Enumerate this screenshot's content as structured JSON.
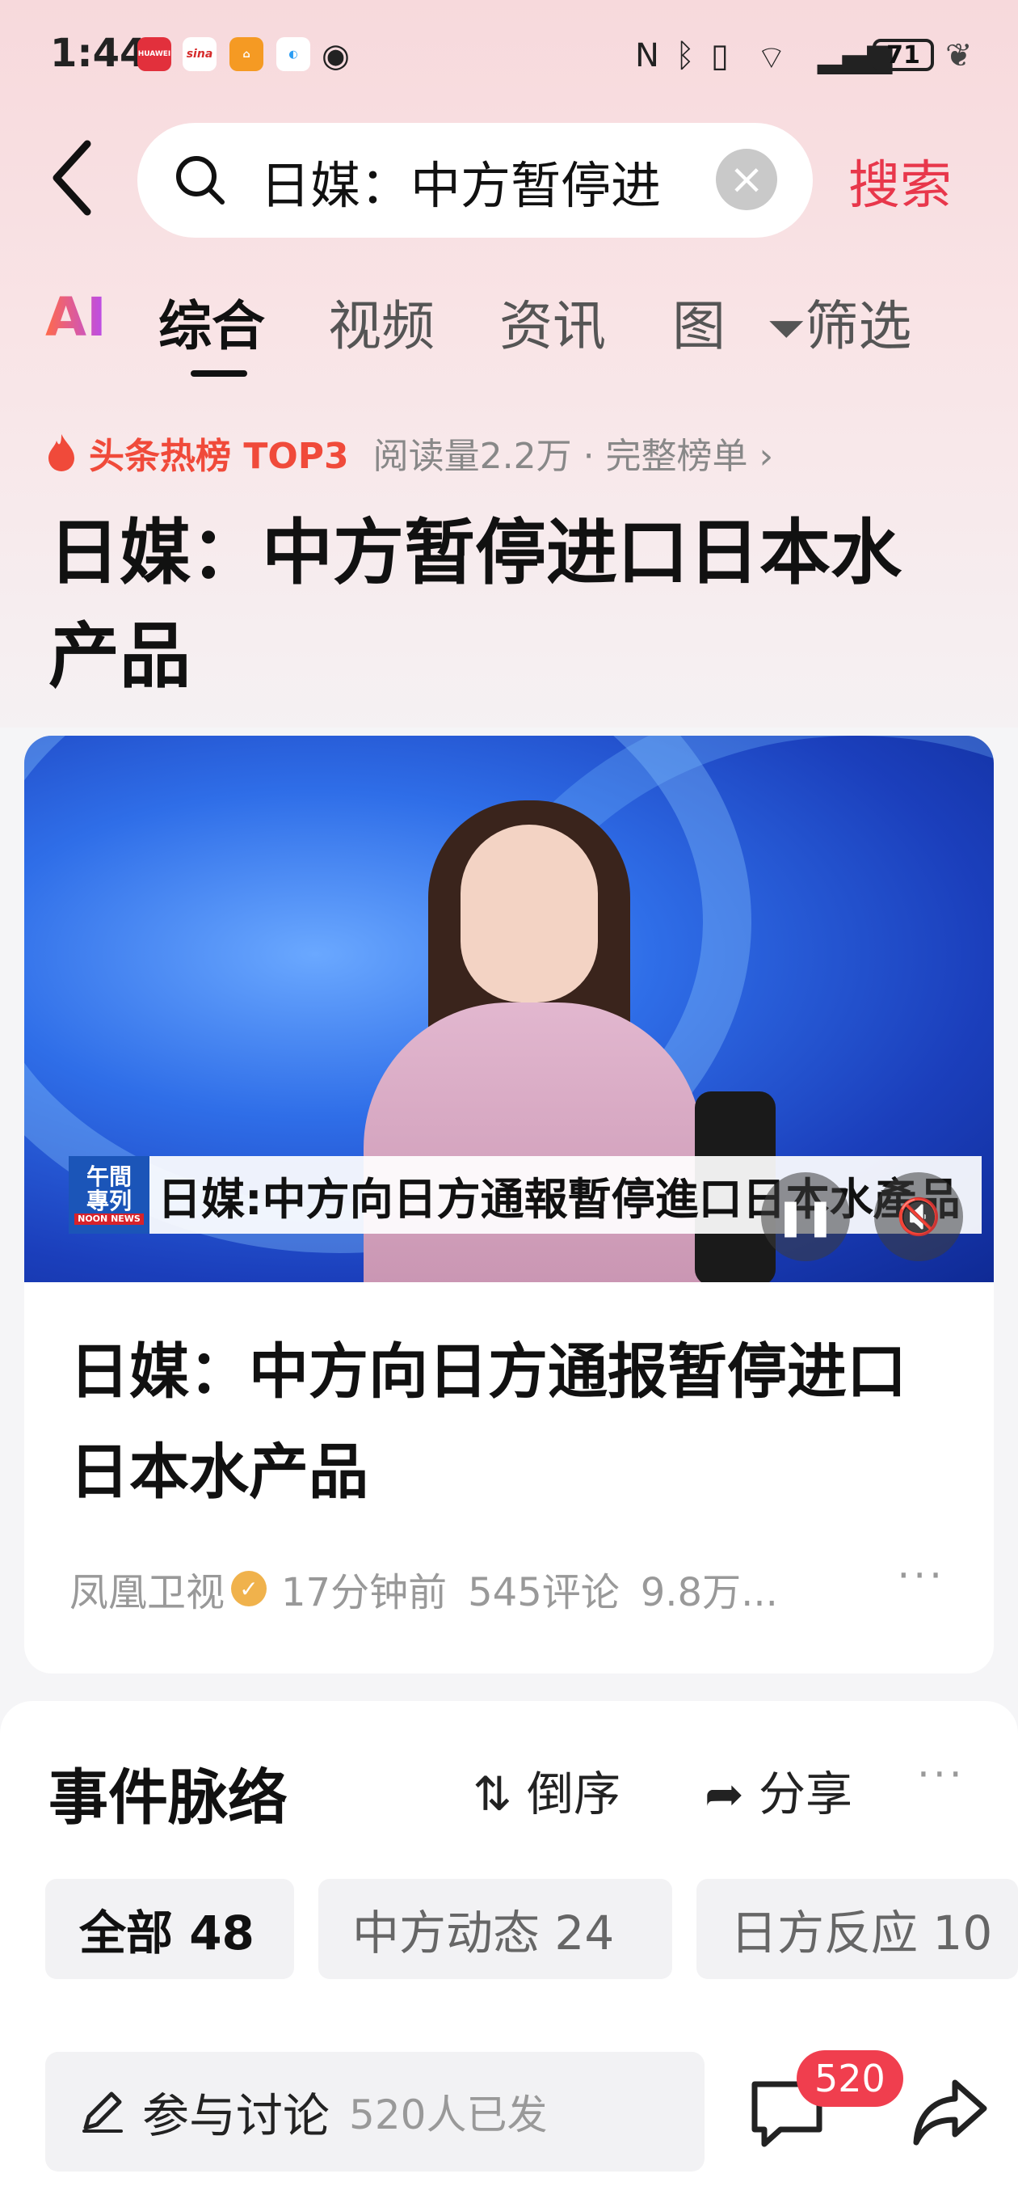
{
  "status_bar": {
    "time": "1:44",
    "app_icons": [
      "huawei-icon",
      "sina-icon",
      "home-app-icon",
      "browser-icon",
      "eye-icon"
    ],
    "huawei_label": "HUAWEI",
    "sina_label": "sina",
    "battery": "71"
  },
  "search": {
    "query": "日媒：中方暂停进",
    "button_label": "搜索"
  },
  "tabs": [
    {
      "label": "AI"
    },
    {
      "label": "综合"
    },
    {
      "label": "视频"
    },
    {
      "label": "资讯"
    },
    {
      "label": "图"
    },
    {
      "label": "筛选"
    }
  ],
  "hot": {
    "label": "头条热榜 TOP3",
    "meta": "阅读量2.2万 · 完整榜单 ›"
  },
  "page_title": "日媒：中方暂停进口日本水产品",
  "card": {
    "caption_logo_line1": "午間",
    "caption_logo_line2": "專列",
    "caption_logo_small": "NOON NEWS",
    "caption_text": "日媒:中方向日方通報暫停進口日本水產品",
    "title": "日媒：中方向日方通报暂停进口日本水产品",
    "source": "凤凰卫视",
    "time_ago": "17分钟前",
    "comments": "545评论",
    "views": "9.8万...",
    "more": "···"
  },
  "events": {
    "title": "事件脉络",
    "sort_label": "倒序",
    "share_label": "分享",
    "more": "···",
    "chips": [
      {
        "label": "全部 48"
      },
      {
        "label": "中方动态 24"
      },
      {
        "label": "日方反应 10"
      }
    ]
  },
  "discussion": {
    "label": "参与讨论",
    "count": "520人已发",
    "badge": "520"
  },
  "colors": {
    "accent": "#e8374b",
    "hot": "#f04a3a",
    "badge": "#f03e4e"
  }
}
